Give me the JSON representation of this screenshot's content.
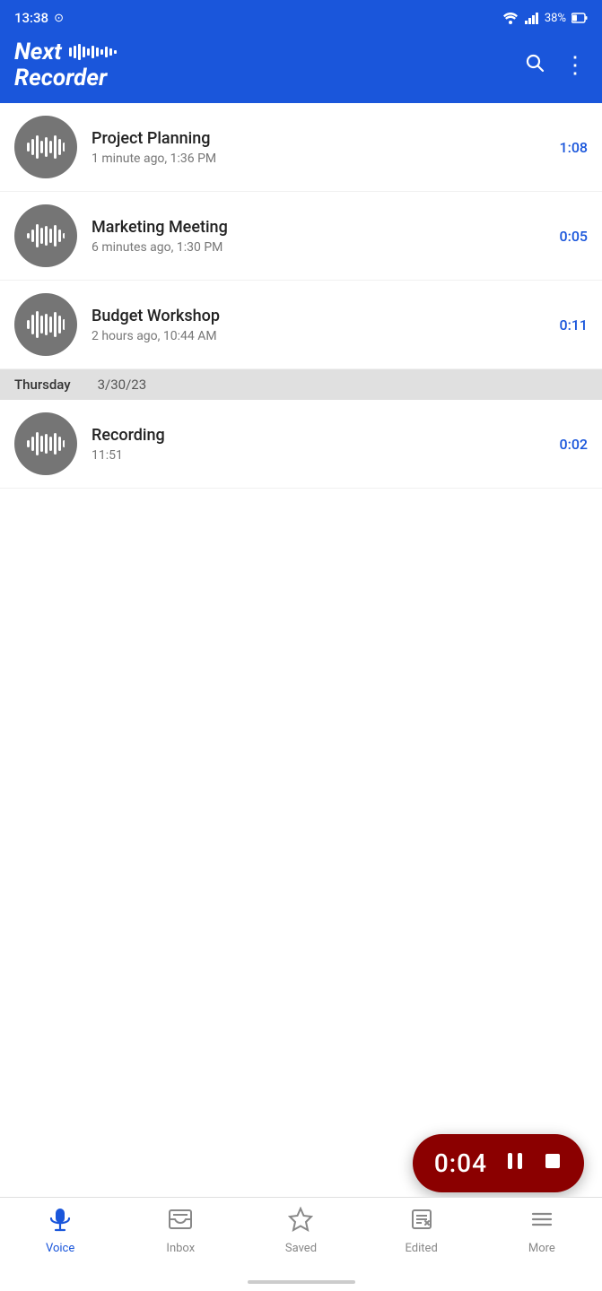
{
  "status": {
    "time": "13:38",
    "battery": "38%"
  },
  "app": {
    "title_line1": "Next",
    "title_line2": "Recorder",
    "search_label": "search",
    "menu_label": "more options"
  },
  "recordings": [
    {
      "title": "Project Planning",
      "meta": "1 minute ago, 1:36 PM",
      "duration": "1:08"
    },
    {
      "title": "Marketing Meeting",
      "meta": "6 minutes ago, 1:30 PM",
      "duration": "0:05"
    },
    {
      "title": "Budget Workshop",
      "meta": "2 hours ago, 10:44 AM",
      "duration": "0:11"
    }
  ],
  "date_separator": {
    "day": "Thursday",
    "date": "3/30/23"
  },
  "recordings_thursday": [
    {
      "title": "Recording",
      "meta": "11:51",
      "duration": "0:02"
    }
  ],
  "player": {
    "time": "0:04",
    "pause_label": "pause",
    "stop_label": "stop"
  },
  "nav": {
    "items": [
      {
        "label": "Voice",
        "active": true
      },
      {
        "label": "Inbox",
        "active": false
      },
      {
        "label": "Saved",
        "active": false
      },
      {
        "label": "Edited",
        "active": false
      },
      {
        "label": "More",
        "active": false
      }
    ]
  }
}
